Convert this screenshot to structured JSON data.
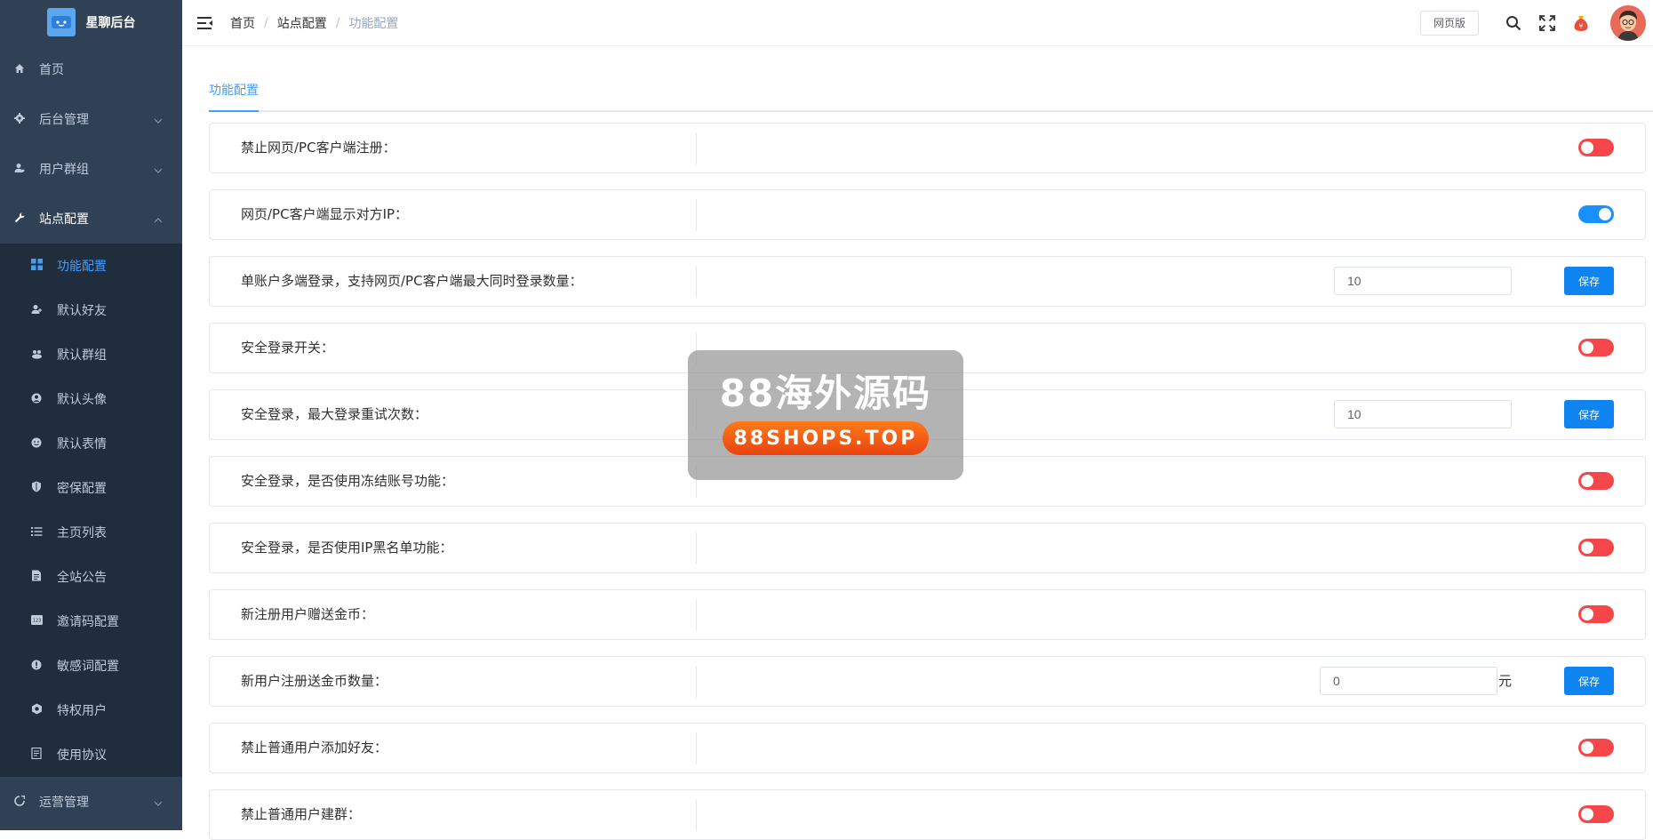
{
  "app": {
    "title": "星聊后台"
  },
  "sidebar": {
    "items": [
      {
        "label": "首页",
        "icon": "home-icon"
      },
      {
        "label": "后台管理",
        "icon": "gear-icon",
        "expandable": true
      },
      {
        "label": "用户群组",
        "icon": "user-icon",
        "expandable": true
      },
      {
        "label": "站点配置",
        "icon": "wrench-icon",
        "expandable": true,
        "expanded": true
      }
    ],
    "submenu": [
      {
        "label": "功能配置",
        "icon": "grid-icon",
        "active": true
      },
      {
        "label": "默认好友",
        "icon": "user-add-icon"
      },
      {
        "label": "默认群组",
        "icon": "group-icon"
      },
      {
        "label": "默认头像",
        "icon": "avatar-icon"
      },
      {
        "label": "默认表情",
        "icon": "emoji-icon"
      },
      {
        "label": "密保配置",
        "icon": "shield-icon"
      },
      {
        "label": "主页列表",
        "icon": "list-icon"
      },
      {
        "label": "全站公告",
        "icon": "notice-icon"
      },
      {
        "label": "邀请码配置",
        "icon": "code-icon"
      },
      {
        "label": "敏感词配置",
        "icon": "warning-icon"
      },
      {
        "label": "特权用户",
        "icon": "vip-icon"
      },
      {
        "label": "使用协议",
        "icon": "document-icon"
      }
    ],
    "bottom_item": {
      "label": "运营管理",
      "icon": "operations-icon",
      "expandable": true
    }
  },
  "header": {
    "breadcrumb": [
      "首页",
      "站点配置",
      "功能配置"
    ],
    "breadcrumb_sep": "/",
    "web_button": "网页版"
  },
  "tabs": [
    {
      "label": "功能配置",
      "active": true
    }
  ],
  "settings": [
    {
      "label": "禁止网页/PC客户端注册：",
      "switch": false
    },
    {
      "label": "网页/PC客户端显示对方IP：",
      "switch": true
    },
    {
      "label": "单账户多端登录，支持网页/PC客户端最大同时登录数量：",
      "input": "10",
      "button": "保存"
    },
    {
      "label": "安全登录开关：",
      "switch": false
    },
    {
      "label": "安全登录，最大登录重试次数：",
      "input": "10",
      "button": "保存"
    },
    {
      "label": "安全登录，是否使用冻结账号功能：",
      "switch": false
    },
    {
      "label": "安全登录，是否使用IP黑名单功能：",
      "switch": false
    },
    {
      "label": "新注册用户赠送金币：",
      "switch": false
    },
    {
      "label": "新用户注册送金币数量：",
      "input": "0",
      "unit": "元",
      "button": "保存"
    },
    {
      "label": "禁止普通用户添加好友：",
      "switch": false
    },
    {
      "label": "禁止普通用户建群：",
      "switch": false
    }
  ],
  "watermark": {
    "title": "88海外源码",
    "subtitle": "88SHOPS.TOP"
  },
  "colors": {
    "sidebar_bg": "#304156",
    "submenu_bg": "#1f2d3d",
    "accent": "#409eff",
    "switch_on": "#1890ff",
    "switch_off": "#f5474a",
    "save_button": "#0d84f0"
  }
}
